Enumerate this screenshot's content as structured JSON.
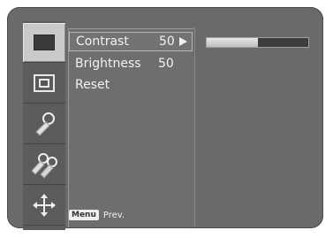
{
  "icons": [
    {
      "name": "picture-icon",
      "selected": true
    },
    {
      "name": "screen-position-icon",
      "selected": false
    },
    {
      "name": "tool-key-icon",
      "selected": false
    },
    {
      "name": "multi-key-icon",
      "selected": false
    },
    {
      "name": "move-arrows-icon",
      "selected": false
    }
  ],
  "menu": {
    "items": [
      {
        "label": "Contrast",
        "value": "50",
        "selected": true
      },
      {
        "label": "Brightness",
        "value": "50",
        "selected": false
      },
      {
        "label": "Reset",
        "value": "",
        "selected": false
      }
    ]
  },
  "slider": {
    "value": 50,
    "max": 100
  },
  "footer": {
    "menu_key": "Menu",
    "prev_label": "Prev."
  }
}
